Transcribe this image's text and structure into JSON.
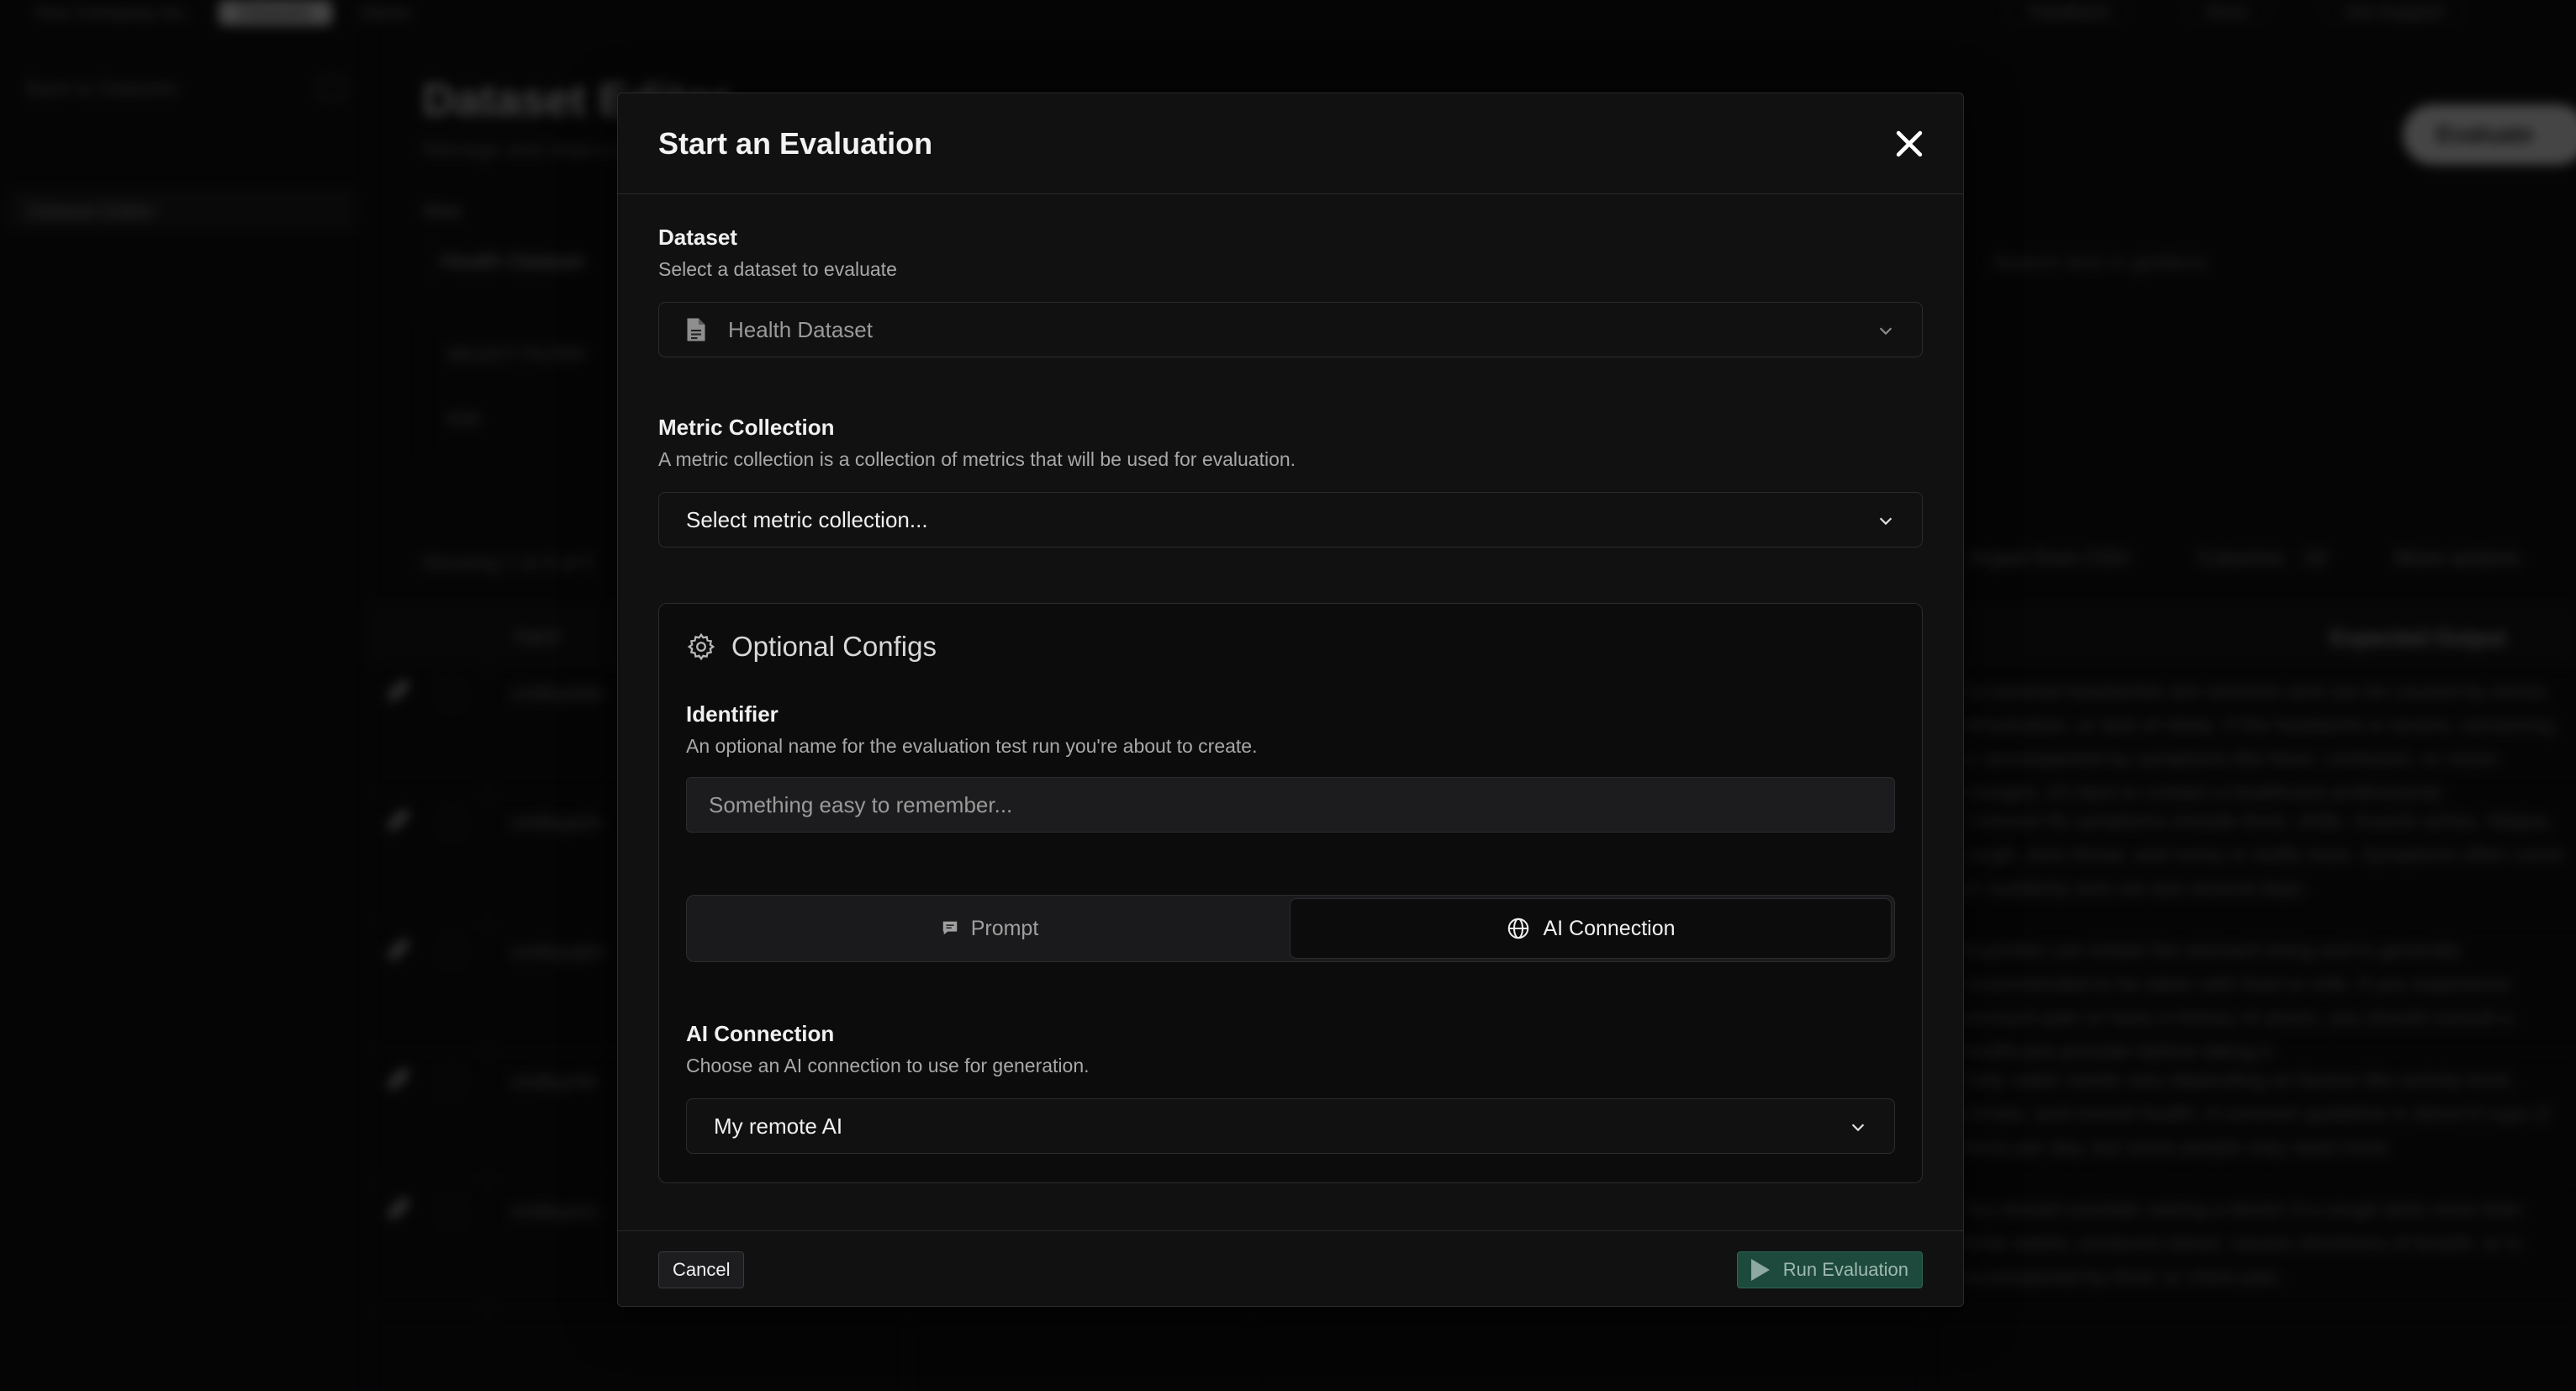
{
  "background": {
    "topbar": [
      "Your Company Inc.",
      "Datasets",
      "Demo"
    ],
    "topbar_right": [
      "Feedback",
      "Docs",
      "Get Support"
    ],
    "sidebar": {
      "back": "Back to Datasets",
      "item": "Dataset Editor"
    },
    "page_title": "Dataset Editor",
    "page_subtitle": "Manage and improve",
    "alias_label": "Alias",
    "alias_value": "Health Dataset",
    "filter_label": "SELECT FILTER",
    "filter_add": "Add",
    "evaluate_button": "Evaluate",
    "search_placeholder": "Search text in goldens",
    "actions": [
      "Import from CSV",
      "Columns · 10",
      "More actions"
    ],
    "showing": "Showing 1 to 5 of 5",
    "column_input": "Input",
    "column_expected": "Expected Output",
    "rows": [
      {
        "id": "cm8xy0ab",
        "text": "Occasional headaches are common and can be caused by stress, dehydration, or lack of sleep. If the headache is severe, worsening, or accompanied by symptoms like fever, confusion, or vision changes, it's best to contact a healthcare professional."
      },
      {
        "id": "cm8xyp2k",
        "text": "Common flu symptoms include fever, chills, muscle aches, fatigue, cough, sore throat, and runny or stuffy nose. Symptoms often come on suddenly and can last several days."
      },
      {
        "id": "cm8xyq9d",
        "text": "Ibuprofen can irritate the stomach lining and is generally recommended to be taken with food or milk. If you experience stomach pain or have a history of ulcers, you should consult a healthcare provider before taking it."
      },
      {
        "id": "cm8xyr4e",
        "text": "Daily water needs vary depending on factors like activity level, climate, and overall health. A common guideline is about 8 cups (2 liters) per day, but some people may need more."
      },
      {
        "id": "cm8xys1c",
        "text": "You should consider seeing a doctor if a cough lasts more than three weeks, produces blood, causes shortness of breath, or is accompanied by fever or chest pain."
      }
    ]
  },
  "modal": {
    "title": "Start an Evaluation",
    "close_icon": "close-icon",
    "dataset": {
      "label": "Dataset",
      "description": "Select a dataset to evaluate",
      "value": "Health Dataset",
      "icon": "document-icon"
    },
    "metric_collection": {
      "label": "Metric Collection",
      "description": "A metric collection is a collection of metrics that will be used for evaluation.",
      "value": "Select metric collection..."
    },
    "optional_configs": {
      "title": "Optional Configs",
      "icon": "gear-icon",
      "identifier": {
        "label": "Identifier",
        "description": "An optional name for the evaluation test run you're about to create.",
        "placeholder": "Something easy to remember...",
        "value": ""
      },
      "tabs": [
        {
          "label": "Prompt",
          "icon": "chat-icon",
          "active": false
        },
        {
          "label": "AI Connection",
          "icon": "globe-icon",
          "active": true
        }
      ],
      "ai_connection": {
        "label": "AI Connection",
        "description": "Choose an AI connection to use for generation.",
        "value": "My remote AI"
      }
    },
    "footer": {
      "cancel": "Cancel",
      "run": "Run Evaluation"
    }
  }
}
